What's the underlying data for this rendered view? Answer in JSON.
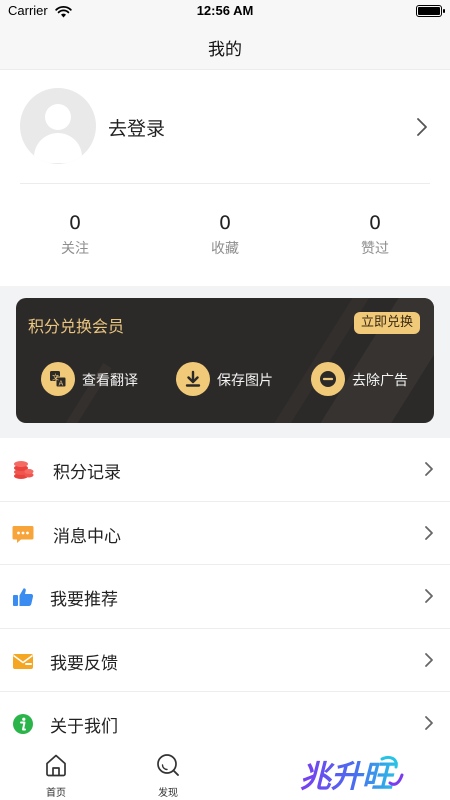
{
  "status_bar": {
    "carrier": "Carrier",
    "time": "12:56 AM"
  },
  "nav": {
    "title": "我的"
  },
  "profile": {
    "login_label": "去登录",
    "stats": [
      {
        "value": "0",
        "label": "关注"
      },
      {
        "value": "0",
        "label": "收藏"
      },
      {
        "value": "0",
        "label": "赞过"
      }
    ]
  },
  "vip": {
    "title": "积分兑换会员",
    "button_label": "立即兑换",
    "features": [
      {
        "label": "查看翻译",
        "icon": "translate-icon"
      },
      {
        "label": "保存图片",
        "icon": "download-icon"
      },
      {
        "label": "去除广告",
        "icon": "minus-circle-icon"
      }
    ]
  },
  "menu": {
    "items": [
      {
        "label": "积分记录",
        "icon": "coins-icon"
      },
      {
        "label": "消息中心",
        "icon": "message-icon"
      },
      {
        "label": "我要推荐",
        "icon": "thumbs-up-icon"
      },
      {
        "label": "我要反馈",
        "icon": "mail-icon"
      },
      {
        "label": "关于我们",
        "icon": "info-icon"
      }
    ]
  },
  "tab_bar": {
    "tabs": [
      {
        "label": "首页",
        "icon": "home-icon"
      },
      {
        "label": "发现",
        "icon": "discover-icon"
      }
    ],
    "brand_text": "兆升旺"
  },
  "colors": {
    "gold": "#f0c979",
    "card_bg": "#2c2a29",
    "coins_red": "#f0554e",
    "message_orange": "#f7a43a",
    "thumbs_blue": "#3b8cf1",
    "mail_orange": "#f5a623",
    "info_green": "#2ab44a",
    "brand_purple": "#7b3cf0",
    "brand_cyan": "#27c3e6"
  }
}
